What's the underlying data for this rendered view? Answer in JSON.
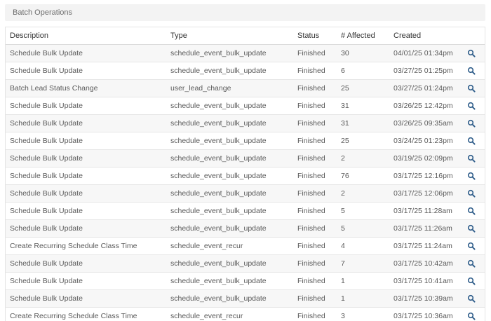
{
  "panel": {
    "title": "Batch Operations"
  },
  "table": {
    "columns": [
      "Description",
      "Type",
      "Status",
      "# Affected",
      "Created"
    ],
    "rows": [
      {
        "description": "Schedule Bulk Update",
        "type": "schedule_event_bulk_update",
        "status": "Finished",
        "affected": "30",
        "created": "04/01/25 01:34pm"
      },
      {
        "description": "Schedule Bulk Update",
        "type": "schedule_event_bulk_update",
        "status": "Finished",
        "affected": "6",
        "created": "03/27/25 01:25pm"
      },
      {
        "description": "Batch Lead Status Change",
        "type": "user_lead_change",
        "status": "Finished",
        "affected": "25",
        "created": "03/27/25 01:24pm"
      },
      {
        "description": "Schedule Bulk Update",
        "type": "schedule_event_bulk_update",
        "status": "Finished",
        "affected": "31",
        "created": "03/26/25 12:42pm"
      },
      {
        "description": "Schedule Bulk Update",
        "type": "schedule_event_bulk_update",
        "status": "Finished",
        "affected": "31",
        "created": "03/26/25 09:35am"
      },
      {
        "description": "Schedule Bulk Update",
        "type": "schedule_event_bulk_update",
        "status": "Finished",
        "affected": "25",
        "created": "03/24/25 01:23pm"
      },
      {
        "description": "Schedule Bulk Update",
        "type": "schedule_event_bulk_update",
        "status": "Finished",
        "affected": "2",
        "created": "03/19/25 02:09pm"
      },
      {
        "description": "Schedule Bulk Update",
        "type": "schedule_event_bulk_update",
        "status": "Finished",
        "affected": "76",
        "created": "03/17/25 12:16pm"
      },
      {
        "description": "Schedule Bulk Update",
        "type": "schedule_event_bulk_update",
        "status": "Finished",
        "affected": "2",
        "created": "03/17/25 12:06pm"
      },
      {
        "description": "Schedule Bulk Update",
        "type": "schedule_event_bulk_update",
        "status": "Finished",
        "affected": "5",
        "created": "03/17/25 11:28am"
      },
      {
        "description": "Schedule Bulk Update",
        "type": "schedule_event_bulk_update",
        "status": "Finished",
        "affected": "5",
        "created": "03/17/25 11:26am"
      },
      {
        "description": "Create Recurring Schedule Class Time",
        "type": "schedule_event_recur",
        "status": "Finished",
        "affected": "4",
        "created": "03/17/25 11:24am"
      },
      {
        "description": "Schedule Bulk Update",
        "type": "schedule_event_bulk_update",
        "status": "Finished",
        "affected": "7",
        "created": "03/17/25 10:42am"
      },
      {
        "description": "Schedule Bulk Update",
        "type": "schedule_event_bulk_update",
        "status": "Finished",
        "affected": "1",
        "created": "03/17/25 10:41am"
      },
      {
        "description": "Schedule Bulk Update",
        "type": "schedule_event_bulk_update",
        "status": "Finished",
        "affected": "1",
        "created": "03/17/25 10:39am"
      },
      {
        "description": "Create Recurring Schedule Class Time",
        "type": "schedule_event_recur",
        "status": "Finished",
        "affected": "3",
        "created": "03/17/25 10:36am"
      }
    ]
  },
  "icons": {
    "row_action": "search-icon"
  },
  "colors": {
    "accent": "#2f5d8a",
    "header_bg": "#f3f3f3",
    "stripe": "#f7f7f7"
  }
}
